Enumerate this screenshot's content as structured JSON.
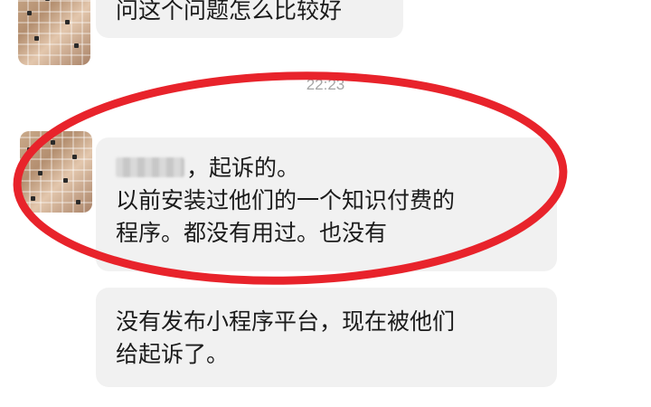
{
  "chat": {
    "messages": [
      {
        "text": "问这个问题怎么比较好"
      },
      {
        "lines": [
          "，起诉的。",
          "以前安装过他们的一个知识付费的",
          "程序。都没有用过。也没有"
        ]
      },
      {
        "lines": [
          "没有发布小程序平台，现在被他们",
          "给起诉了。"
        ]
      }
    ],
    "timestamp": "22:23"
  },
  "colors": {
    "bubble": "#f1f1f1",
    "text": "#1b1b1b",
    "timestamp": "#a5a5a5",
    "annotation": "#e8232b"
  },
  "icons": [
    "blurred-avatar",
    "redacted-name"
  ]
}
